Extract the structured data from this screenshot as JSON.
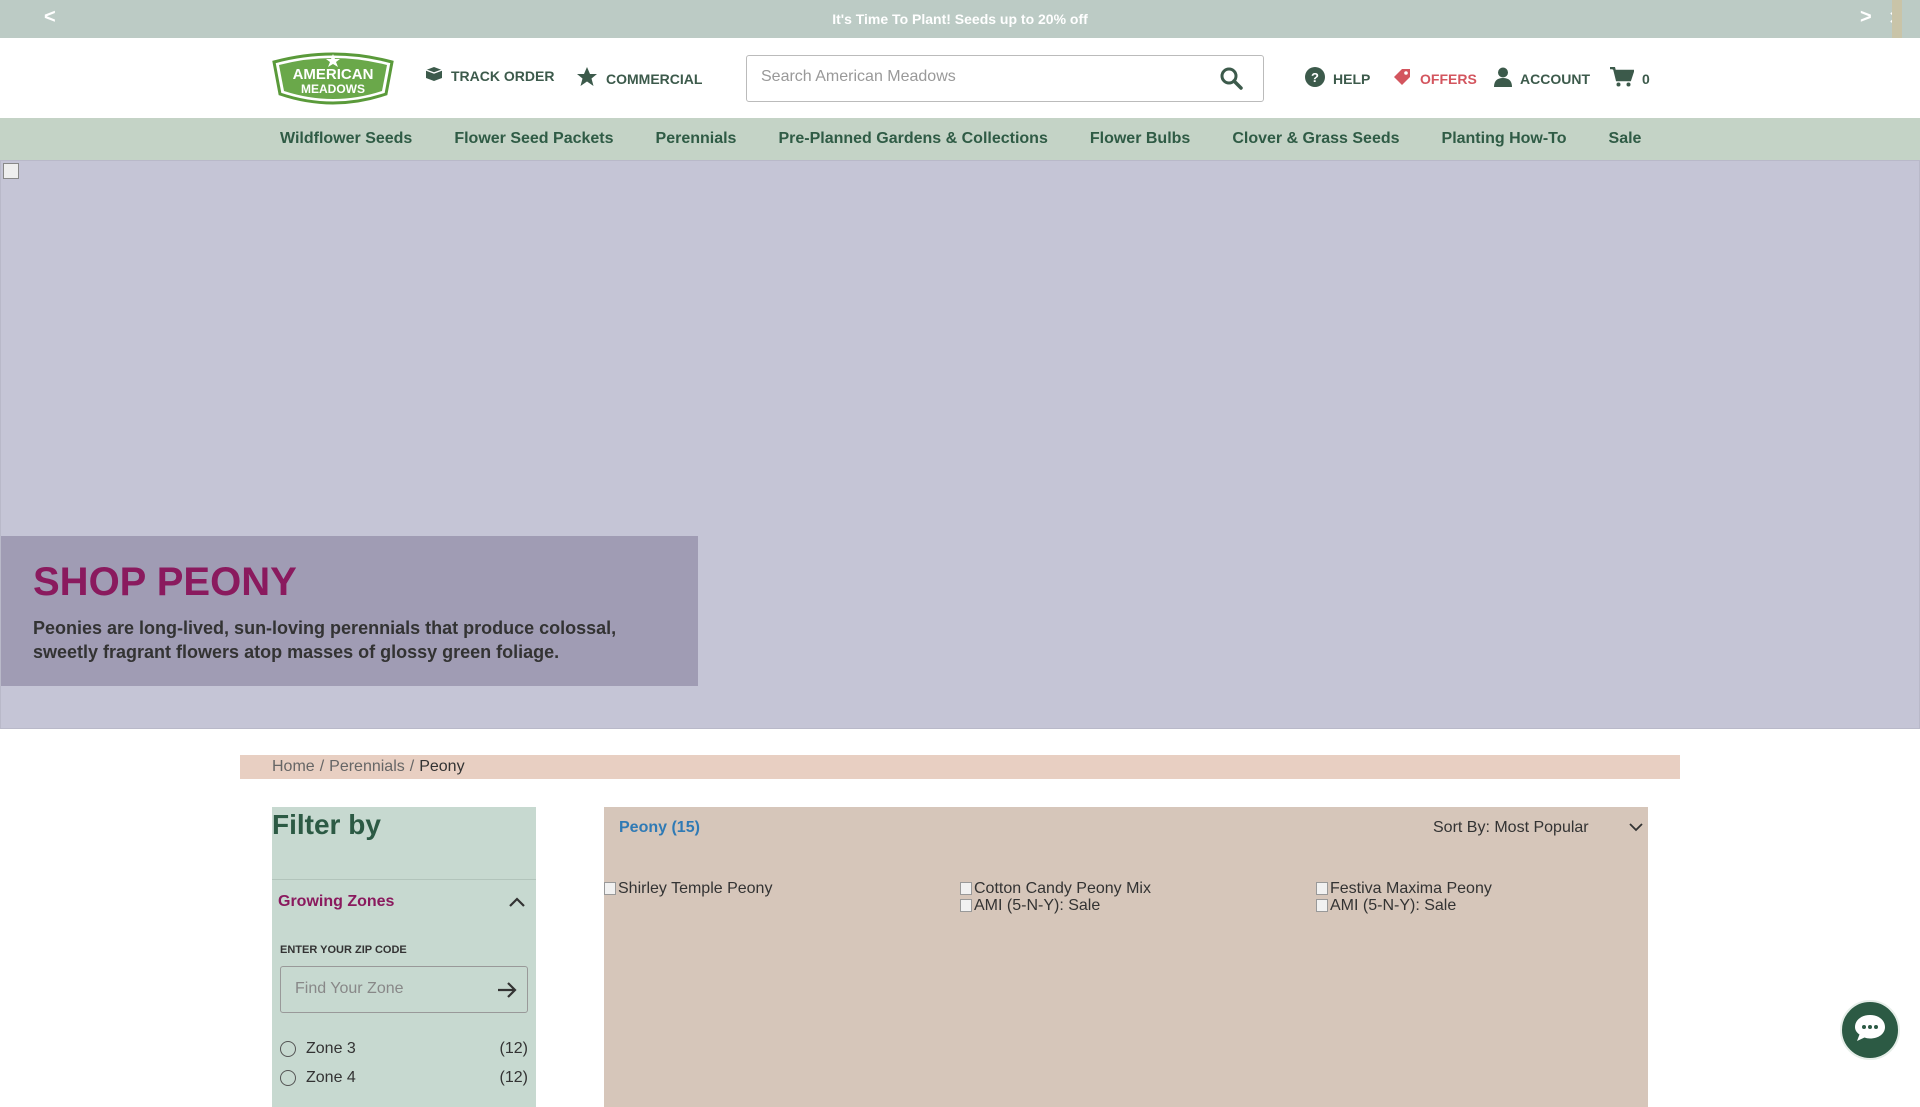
{
  "promo": {
    "text": "It's Time To Plant! Seeds up to 20% off",
    "prev_label": "<",
    "next_label": ">",
    "close_label": "✕"
  },
  "header": {
    "logo_text_top": "AMERICAN",
    "logo_text_bottom": "MEADOWS",
    "track_order": "TRACK ORDER",
    "commercial": "COMMERCIAL",
    "search_placeholder": "Search American Meadows",
    "help": "HELP",
    "offers": "OFFERS",
    "account": "ACCOUNT",
    "cart_count": "0"
  },
  "nav": {
    "items": [
      "Wildflower Seeds",
      "Flower Seed Packets",
      "Perennials",
      "Pre-Planned Gardens & Collections",
      "Flower Bulbs",
      "Clover & Grass Seeds",
      "Planting How-To",
      "Sale"
    ]
  },
  "hero": {
    "title": "SHOP PEONY",
    "description": "Peonies are long-lived, sun-loving perennials that produce colossal, sweetly fragrant flowers atop masses of glossy green foliage."
  },
  "breadcrumb": {
    "items": [
      "Home",
      "Perennials"
    ],
    "separator": "/",
    "current": "Peony"
  },
  "sidebar": {
    "title": "Filter by",
    "zones_heading": "Growing Zones",
    "zip_label": "ENTER YOUR ZIP CODE",
    "zip_placeholder": "Find Your Zone",
    "zones": [
      {
        "name": "Zone 3",
        "count": "(12)"
      },
      {
        "name": "Zone 4",
        "count": "(12)"
      }
    ]
  },
  "products": {
    "results": "Peony (15)",
    "sort_label": "Sort By: Most Popular",
    "items": [
      {
        "name": "Shirley Temple Peony",
        "badge": ""
      },
      {
        "name": "Cotton Candy Peony Mix",
        "badge": "AMI (5-N-Y): Sale"
      },
      {
        "name": "Festiva Maxima Peony",
        "badge": "AMI (5-N-Y): Sale"
      }
    ]
  },
  "colors": {
    "brand_green": "#2c5a44",
    "accent_magenta": "#8a1a5e",
    "offers_red": "#d3555e",
    "link_blue": "#2f7ab5"
  }
}
